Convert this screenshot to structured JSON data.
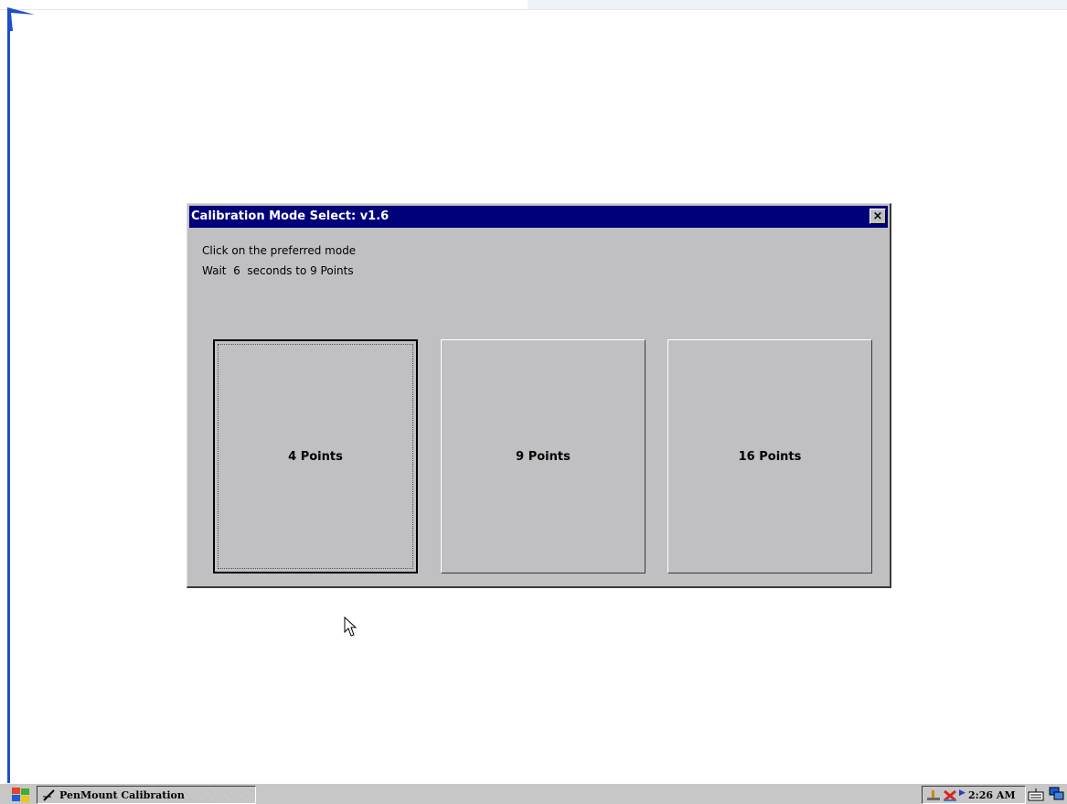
{
  "dialog": {
    "title": "Calibration Mode Select: v1.6",
    "close_label": "×",
    "instruction": "Click on the preferred mode",
    "countdown": "Wait  6  seconds to 9 Points",
    "modes": [
      {
        "label": "4 Points",
        "focused": true
      },
      {
        "label": "9 Points",
        "focused": false
      },
      {
        "label": "16 Points",
        "focused": false
      }
    ]
  },
  "taskbar": {
    "start_icon": "windows-flag-icon",
    "task_label": "PenMount Calibration",
    "task_icon": "pen-icon",
    "clock": "2:26 AM",
    "tray_icons": [
      "network-icon",
      "switch-icon",
      "keyboard-icon",
      "desktop-icon"
    ]
  },
  "colors": {
    "titlebar": "#00007a",
    "dialog_face": "#c0bfc2",
    "marker_blue": "#1f4fc8"
  }
}
